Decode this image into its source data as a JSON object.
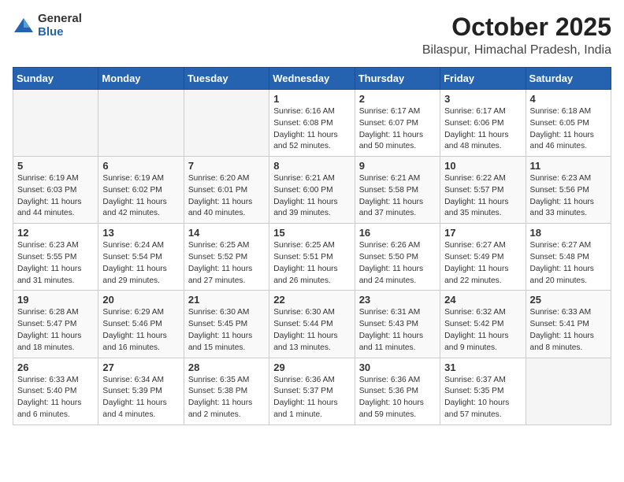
{
  "header": {
    "logo_general": "General",
    "logo_blue": "Blue",
    "month": "October 2025",
    "location": "Bilaspur, Himachal Pradesh, India"
  },
  "days_of_week": [
    "Sunday",
    "Monday",
    "Tuesday",
    "Wednesday",
    "Thursday",
    "Friday",
    "Saturday"
  ],
  "weeks": [
    [
      {
        "day": "",
        "info": ""
      },
      {
        "day": "",
        "info": ""
      },
      {
        "day": "",
        "info": ""
      },
      {
        "day": "1",
        "info": "Sunrise: 6:16 AM\nSunset: 6:08 PM\nDaylight: 11 hours and 52 minutes."
      },
      {
        "day": "2",
        "info": "Sunrise: 6:17 AM\nSunset: 6:07 PM\nDaylight: 11 hours and 50 minutes."
      },
      {
        "day": "3",
        "info": "Sunrise: 6:17 AM\nSunset: 6:06 PM\nDaylight: 11 hours and 48 minutes."
      },
      {
        "day": "4",
        "info": "Sunrise: 6:18 AM\nSunset: 6:05 PM\nDaylight: 11 hours and 46 minutes."
      }
    ],
    [
      {
        "day": "5",
        "info": "Sunrise: 6:19 AM\nSunset: 6:03 PM\nDaylight: 11 hours and 44 minutes."
      },
      {
        "day": "6",
        "info": "Sunrise: 6:19 AM\nSunset: 6:02 PM\nDaylight: 11 hours and 42 minutes."
      },
      {
        "day": "7",
        "info": "Sunrise: 6:20 AM\nSunset: 6:01 PM\nDaylight: 11 hours and 40 minutes."
      },
      {
        "day": "8",
        "info": "Sunrise: 6:21 AM\nSunset: 6:00 PM\nDaylight: 11 hours and 39 minutes."
      },
      {
        "day": "9",
        "info": "Sunrise: 6:21 AM\nSunset: 5:58 PM\nDaylight: 11 hours and 37 minutes."
      },
      {
        "day": "10",
        "info": "Sunrise: 6:22 AM\nSunset: 5:57 PM\nDaylight: 11 hours and 35 minutes."
      },
      {
        "day": "11",
        "info": "Sunrise: 6:23 AM\nSunset: 5:56 PM\nDaylight: 11 hours and 33 minutes."
      }
    ],
    [
      {
        "day": "12",
        "info": "Sunrise: 6:23 AM\nSunset: 5:55 PM\nDaylight: 11 hours and 31 minutes."
      },
      {
        "day": "13",
        "info": "Sunrise: 6:24 AM\nSunset: 5:54 PM\nDaylight: 11 hours and 29 minutes."
      },
      {
        "day": "14",
        "info": "Sunrise: 6:25 AM\nSunset: 5:52 PM\nDaylight: 11 hours and 27 minutes."
      },
      {
        "day": "15",
        "info": "Sunrise: 6:25 AM\nSunset: 5:51 PM\nDaylight: 11 hours and 26 minutes."
      },
      {
        "day": "16",
        "info": "Sunrise: 6:26 AM\nSunset: 5:50 PM\nDaylight: 11 hours and 24 minutes."
      },
      {
        "day": "17",
        "info": "Sunrise: 6:27 AM\nSunset: 5:49 PM\nDaylight: 11 hours and 22 minutes."
      },
      {
        "day": "18",
        "info": "Sunrise: 6:27 AM\nSunset: 5:48 PM\nDaylight: 11 hours and 20 minutes."
      }
    ],
    [
      {
        "day": "19",
        "info": "Sunrise: 6:28 AM\nSunset: 5:47 PM\nDaylight: 11 hours and 18 minutes."
      },
      {
        "day": "20",
        "info": "Sunrise: 6:29 AM\nSunset: 5:46 PM\nDaylight: 11 hours and 16 minutes."
      },
      {
        "day": "21",
        "info": "Sunrise: 6:30 AM\nSunset: 5:45 PM\nDaylight: 11 hours and 15 minutes."
      },
      {
        "day": "22",
        "info": "Sunrise: 6:30 AM\nSunset: 5:44 PM\nDaylight: 11 hours and 13 minutes."
      },
      {
        "day": "23",
        "info": "Sunrise: 6:31 AM\nSunset: 5:43 PM\nDaylight: 11 hours and 11 minutes."
      },
      {
        "day": "24",
        "info": "Sunrise: 6:32 AM\nSunset: 5:42 PM\nDaylight: 11 hours and 9 minutes."
      },
      {
        "day": "25",
        "info": "Sunrise: 6:33 AM\nSunset: 5:41 PM\nDaylight: 11 hours and 8 minutes."
      }
    ],
    [
      {
        "day": "26",
        "info": "Sunrise: 6:33 AM\nSunset: 5:40 PM\nDaylight: 11 hours and 6 minutes."
      },
      {
        "day": "27",
        "info": "Sunrise: 6:34 AM\nSunset: 5:39 PM\nDaylight: 11 hours and 4 minutes."
      },
      {
        "day": "28",
        "info": "Sunrise: 6:35 AM\nSunset: 5:38 PM\nDaylight: 11 hours and 2 minutes."
      },
      {
        "day": "29",
        "info": "Sunrise: 6:36 AM\nSunset: 5:37 PM\nDaylight: 11 hours and 1 minute."
      },
      {
        "day": "30",
        "info": "Sunrise: 6:36 AM\nSunset: 5:36 PM\nDaylight: 10 hours and 59 minutes."
      },
      {
        "day": "31",
        "info": "Sunrise: 6:37 AM\nSunset: 5:35 PM\nDaylight: 10 hours and 57 minutes."
      },
      {
        "day": "",
        "info": ""
      }
    ]
  ]
}
